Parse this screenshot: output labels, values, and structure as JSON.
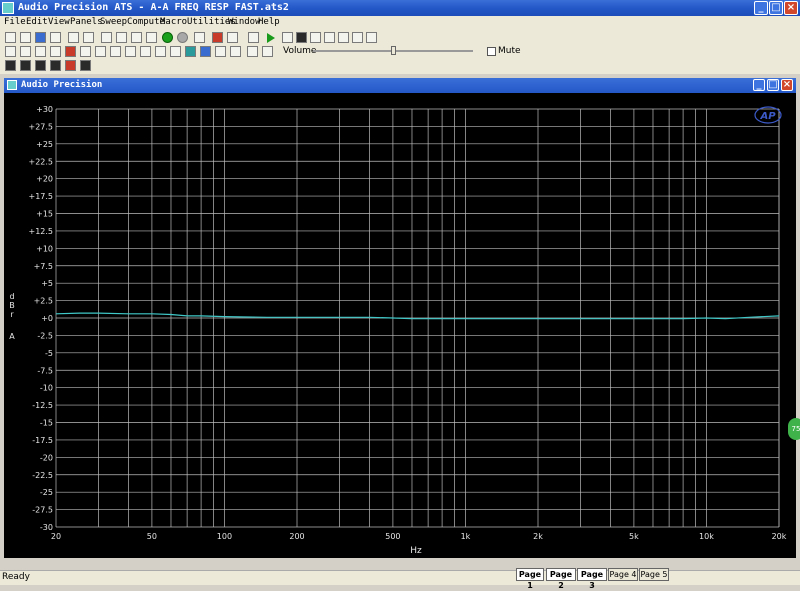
{
  "app": {
    "title": "Audio Precision ATS - A-A FREQ RESP FAST.ats2",
    "window_buttons": {
      "min": "_",
      "max": "□",
      "close": "×"
    }
  },
  "menu": [
    "File",
    "Edit",
    "View",
    "Panels",
    "Sweep",
    "Compute",
    "Macro",
    "Utilities",
    "Window",
    "Help"
  ],
  "toolbar": {
    "volume_label": "Volume",
    "volume_level": 0.5,
    "mute_label": "Mute",
    "mute_checked": false
  },
  "document": {
    "title": "Audio Precision",
    "logo_text": "AP"
  },
  "chart_data": {
    "type": "line",
    "x_scale": "log",
    "xlabel": "Hz",
    "ylabel": [
      "d",
      "B",
      "r",
      "A"
    ],
    "xlim": [
      20,
      20000
    ],
    "ylim": [
      -30,
      30
    ],
    "grid": true,
    "x_ticks": [
      {
        "v": 20,
        "t": "20"
      },
      {
        "v": 50,
        "t": "50"
      },
      {
        "v": 100,
        "t": "100"
      },
      {
        "v": 200,
        "t": "200"
      },
      {
        "v": 500,
        "t": "500"
      },
      {
        "v": 1000,
        "t": "1k"
      },
      {
        "v": 2000,
        "t": "2k"
      },
      {
        "v": 5000,
        "t": "5k"
      },
      {
        "v": 10000,
        "t": "10k"
      },
      {
        "v": 20000,
        "t": "20k"
      }
    ],
    "y_ticks": [
      {
        "v": 30,
        "t": "+30"
      },
      {
        "v": 27.5,
        "t": "+27.5"
      },
      {
        "v": 25,
        "t": "+25"
      },
      {
        "v": 22.5,
        "t": "+22.5"
      },
      {
        "v": 20,
        "t": "+20"
      },
      {
        "v": 17.5,
        "t": "+17.5"
      },
      {
        "v": 15,
        "t": "+15"
      },
      {
        "v": 12.5,
        "t": "+12.5"
      },
      {
        "v": 10,
        "t": "+10"
      },
      {
        "v": 7.5,
        "t": "+7.5"
      },
      {
        "v": 5,
        "t": "+5"
      },
      {
        "v": 2.5,
        "t": "+2.5"
      },
      {
        "v": 0,
        "t": "+0"
      },
      {
        "v": -2.5,
        "t": "-2.5"
      },
      {
        "v": -5,
        "t": "-5"
      },
      {
        "v": -7.5,
        "t": "-7.5"
      },
      {
        "v": -10,
        "t": "-10"
      },
      {
        "v": -12.5,
        "t": "-12.5"
      },
      {
        "v": -15,
        "t": "-15"
      },
      {
        "v": -17.5,
        "t": "-17.5"
      },
      {
        "v": -20,
        "t": "-20"
      },
      {
        "v": -22.5,
        "t": "-22.5"
      },
      {
        "v": -25,
        "t": "-25"
      },
      {
        "v": -27.5,
        "t": "-27.5"
      },
      {
        "v": -30,
        "t": "-30"
      }
    ],
    "series": [
      {
        "color": "#40c8c8",
        "x": [
          20,
          25,
          30,
          40,
          50,
          60,
          70,
          80,
          100,
          150,
          200,
          300,
          400,
          500,
          600,
          800,
          1000,
          1500,
          2000,
          3000,
          4000,
          5000,
          6000,
          8000,
          10000,
          12000,
          15000,
          20000
        ],
        "y": [
          0.6,
          0.7,
          0.7,
          0.6,
          0.6,
          0.5,
          0.3,
          0.3,
          0.2,
          0.1,
          0.1,
          0.1,
          0.1,
          0.0,
          -0.1,
          -0.1,
          -0.1,
          -0.1,
          -0.1,
          -0.1,
          -0.1,
          -0.1,
          -0.1,
          -0.1,
          0.0,
          -0.1,
          0.1,
          0.3
        ]
      }
    ]
  },
  "status": {
    "text": "Ready"
  },
  "pages": [
    "Page 1",
    "Page 2",
    "Page 3",
    "Page 4",
    "Page 5"
  ],
  "side_badge": "75"
}
